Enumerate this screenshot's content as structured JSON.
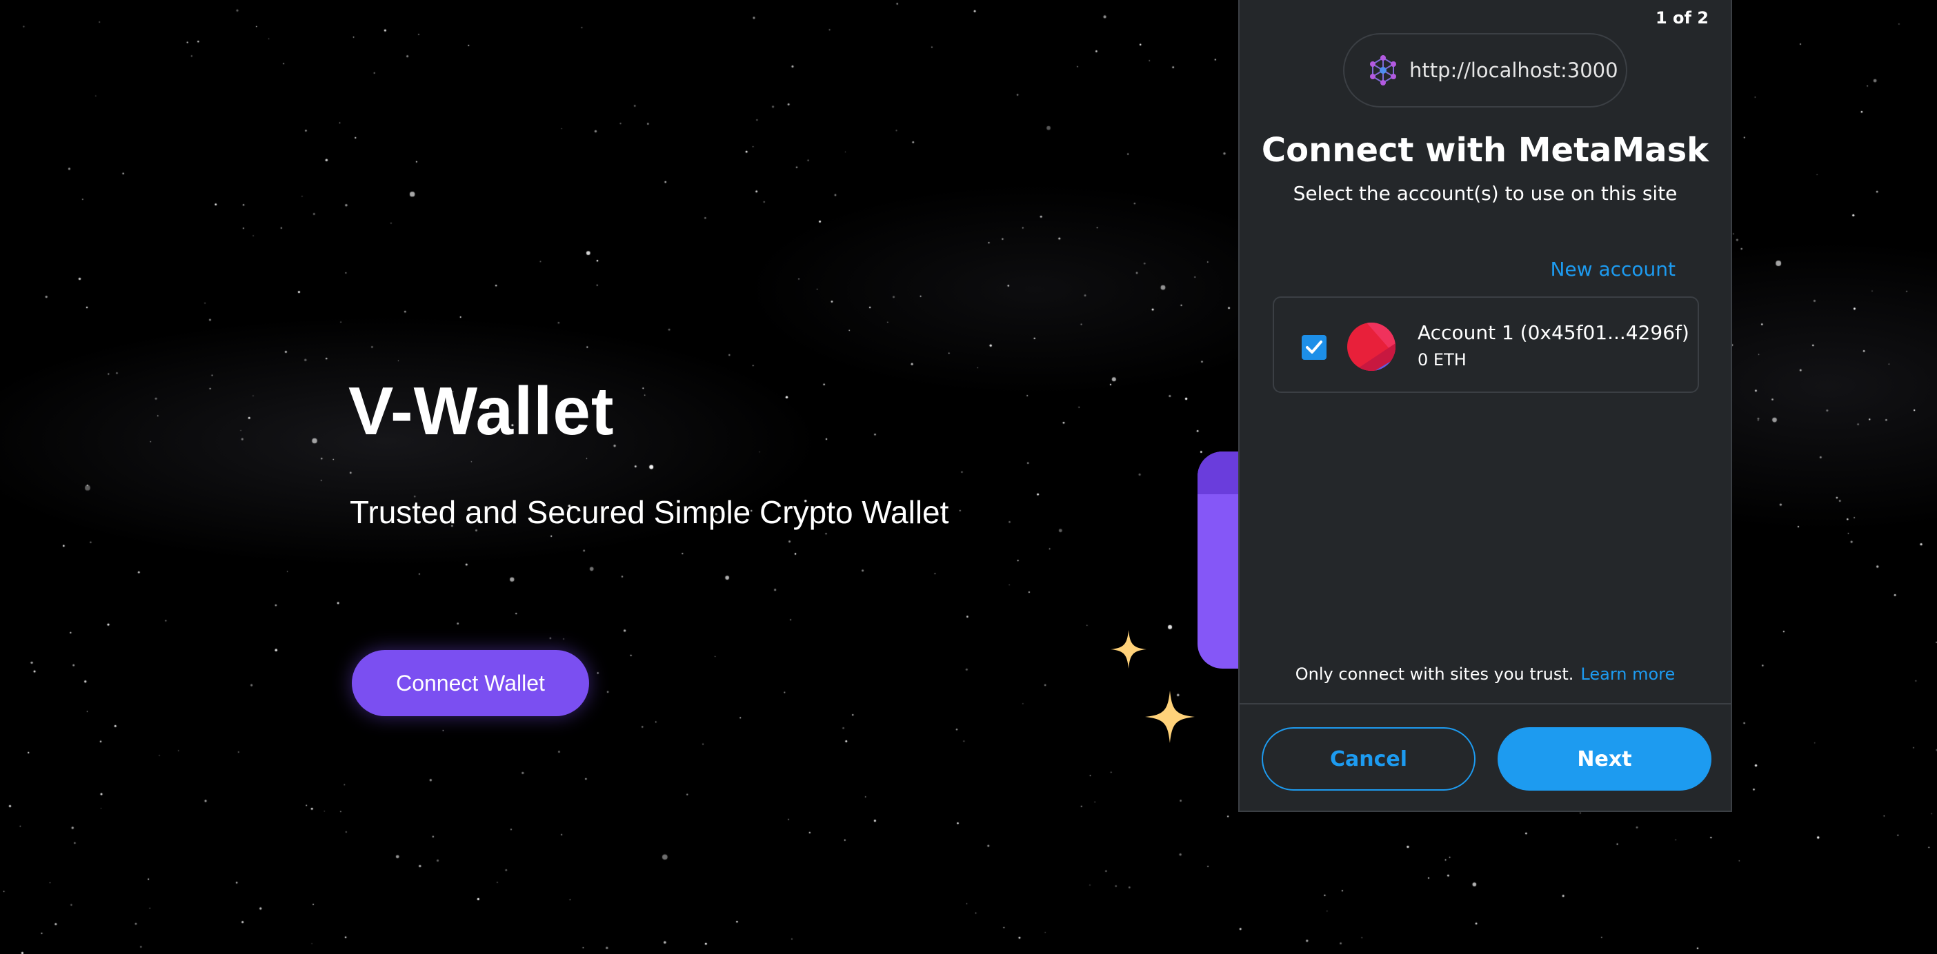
{
  "hero": {
    "title": "V-Wallet",
    "subtitle": "Trusted and Secured Simple Crypto Wallet",
    "connect_label": "Connect Wallet"
  },
  "metamask": {
    "counter": "1 of 2",
    "origin": "http://localhost:3000",
    "title": "Connect with MetaMask",
    "subtitle": "Select the account(s) to use on this site",
    "new_account_label": "New account",
    "account": {
      "name": "Account 1 (0x45f01...4296f)",
      "balance": "0 ETH",
      "checked": true
    },
    "trust_text": "Only connect with sites you trust.",
    "learn_more_label": "Learn more",
    "cancel_label": "Cancel",
    "next_label": "Next"
  },
  "colors": {
    "accent_purple": "#7b4ff1",
    "metamask_blue": "#1d9bf0",
    "popup_bg": "#24272a",
    "sparkle": "#ffd27a"
  },
  "icons": [
    "network-icon",
    "checkmark-icon",
    "account-avatar",
    "sparkle-icon"
  ]
}
